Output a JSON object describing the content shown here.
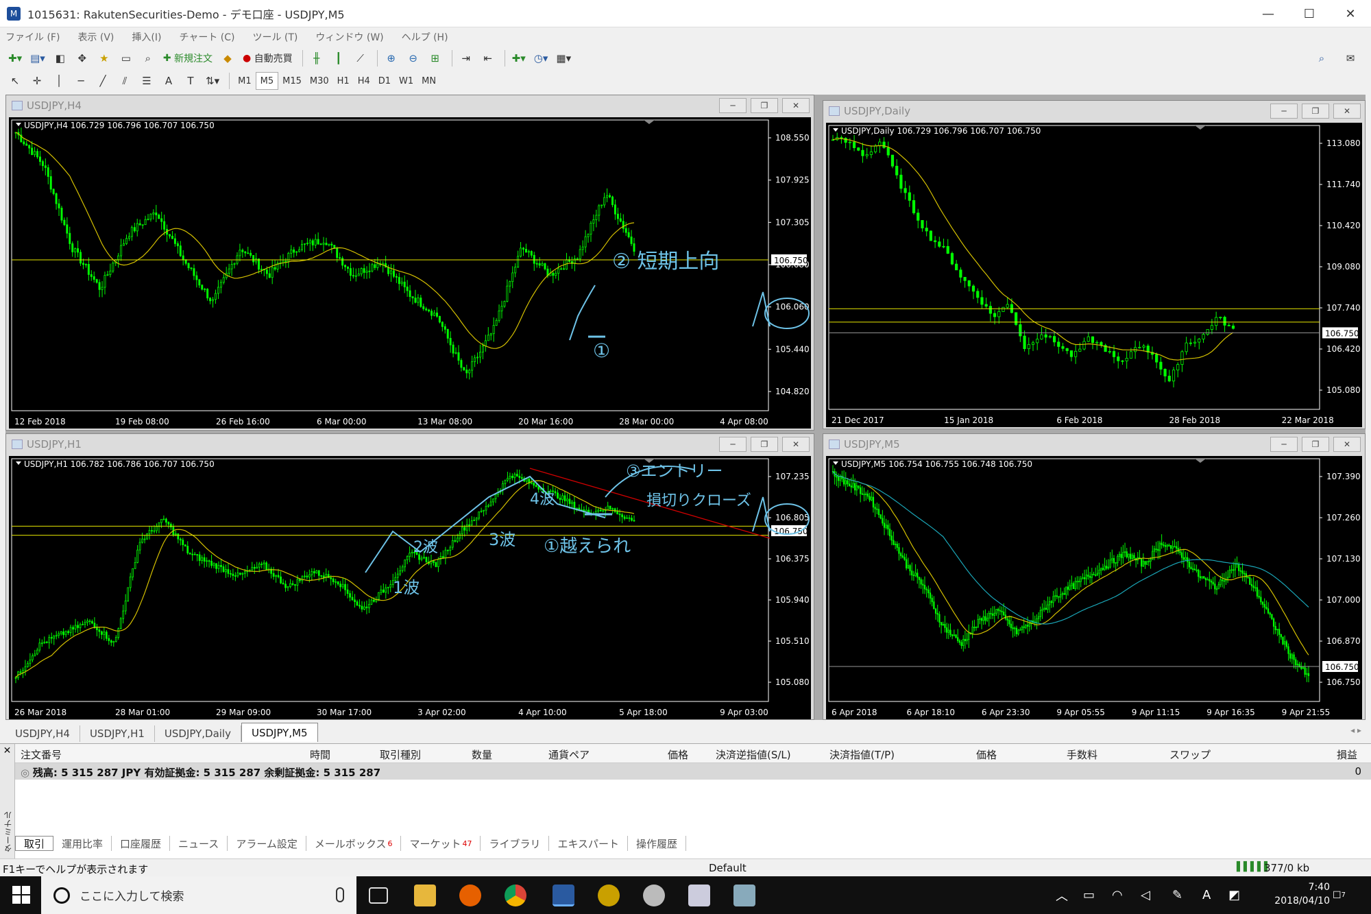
{
  "window": {
    "title": "1015631: RakutenSecurities-Demo - デモ口座 - USDJPY,M5",
    "min": "—",
    "max": "☐",
    "close": "✕"
  },
  "menu": [
    "ファイル (F)",
    "表示 (V)",
    "挿入(I)",
    "チャート (C)",
    "ツール (T)",
    "ウィンドウ (W)",
    "ヘルプ (H)"
  ],
  "toolbar": {
    "new_order": "新規注文",
    "auto_trade": "自動売買"
  },
  "timeframes": [
    "M1",
    "M5",
    "M15",
    "M30",
    "H1",
    "H4",
    "D1",
    "W1",
    "MN"
  ],
  "active_timeframe": "M5",
  "charts": {
    "h4": {
      "title": "USDJPY,H4",
      "info": "USDJPY,H4  106.729 106.796 106.707 106.750",
      "price_labels": [
        "108.550",
        "107.925",
        "107.305",
        "106.680",
        "106.060",
        "105.440",
        "104.820"
      ],
      "current": "106.750",
      "date_labels": [
        "12 Feb 2018",
        "19 Feb 08:00",
        "26 Feb 16:00",
        "6 Mar 00:00",
        "13 Mar 08:00",
        "20 Mar 16:00",
        "28 Mar 00:00",
        "4 Apr 08:00"
      ],
      "annotations": [
        "② 短期上向",
        "①"
      ]
    },
    "daily": {
      "title": "USDJPY,Daily",
      "info": "USDJPY,Daily  106.729 106.796 106.707 106.750",
      "price_labels": [
        "113.080",
        "111.740",
        "110.420",
        "109.080",
        "107.740",
        "106.420",
        "105.080"
      ],
      "current": "106.750",
      "date_labels": [
        "21 Dec 2017",
        "15 Jan 2018",
        "6 Feb 2018",
        "28 Feb 2018",
        "22 Mar 2018"
      ]
    },
    "h1": {
      "title": "USDJPY,H1",
      "info": "USDJPY,H1  106.782 106.786 106.707 106.750",
      "price_labels": [
        "107.235",
        "106.805",
        "106.375",
        "105.940",
        "105.510",
        "105.080"
      ],
      "current": "106.750",
      "date_labels": [
        "26 Mar 2018",
        "28 Mar 01:00",
        "29 Mar 09:00",
        "30 Mar 17:00",
        "3 Apr 02:00",
        "4 Apr 10:00",
        "5 Apr 18:00",
        "9 Apr 03:00"
      ],
      "annotations": [
        "③エントリー",
        "損切りクローズ",
        "4波",
        "2波",
        "3波",
        "1波",
        "①越えられ"
      ]
    },
    "m5": {
      "title": "USDJPY,M5",
      "info": "USDJPY,M5  106.754 106.755 106.748 106.750",
      "price_labels": [
        "107.390",
        "107.260",
        "107.130",
        "107.000",
        "106.870",
        "106.750"
      ],
      "current": "106.750",
      "date_labels": [
        "6 Apr 2018",
        "6 Apr 18:10",
        "6 Apr 23:30",
        "9 Apr 05:55",
        "9 Apr 11:15",
        "9 Apr 16:35",
        "9 Apr 21:55"
      ]
    }
  },
  "chart_tabs": [
    "USDJPY,H4",
    "USDJPY,H1",
    "USDJPY,Daily",
    "USDJPY,M5"
  ],
  "active_chart_tab": "USDJPY,M5",
  "terminal": {
    "side_label": "ターミナル",
    "columns": [
      "注文番号",
      "時間",
      "取引種別",
      "数量",
      "通貨ペア",
      "価格",
      "決済逆指値(S/L)",
      "決済指値(T/P)",
      "価格",
      "手数料",
      "スワップ",
      "損益"
    ],
    "balance_row": "残高: 5 315 287 JPY  有効証拠金: 5 315 287  余剰証拠金: 5 315 287",
    "balance_pl": "0",
    "tabs": [
      {
        "label": "取引",
        "badge": ""
      },
      {
        "label": "運用比率",
        "badge": ""
      },
      {
        "label": "口座履歴",
        "badge": ""
      },
      {
        "label": "ニュース",
        "badge": ""
      },
      {
        "label": "アラーム設定",
        "badge": ""
      },
      {
        "label": "メールボックス",
        "badge": "6"
      },
      {
        "label": "マーケット",
        "badge": "47"
      },
      {
        "label": "ライブラリ",
        "badge": ""
      },
      {
        "label": "エキスパート",
        "badge": ""
      },
      {
        "label": "操作履歴",
        "badge": ""
      }
    ]
  },
  "status": {
    "help": "F1キーでヘルプが表示されます",
    "profile": "Default",
    "traffic": "377/0 kb"
  },
  "taskbar": {
    "search_placeholder": "ここに入力して検索",
    "time": "7:40",
    "date": "2018/04/10",
    "notifications": "7"
  },
  "colors": {
    "chart_bg": "#000000",
    "candle": "#00ff00",
    "ma": "#d4c000",
    "level": "#e8e800",
    "annotation": "#6ec3e8",
    "trendline": "#d00000",
    "m5_ma2": "#1aa6b7"
  }
}
